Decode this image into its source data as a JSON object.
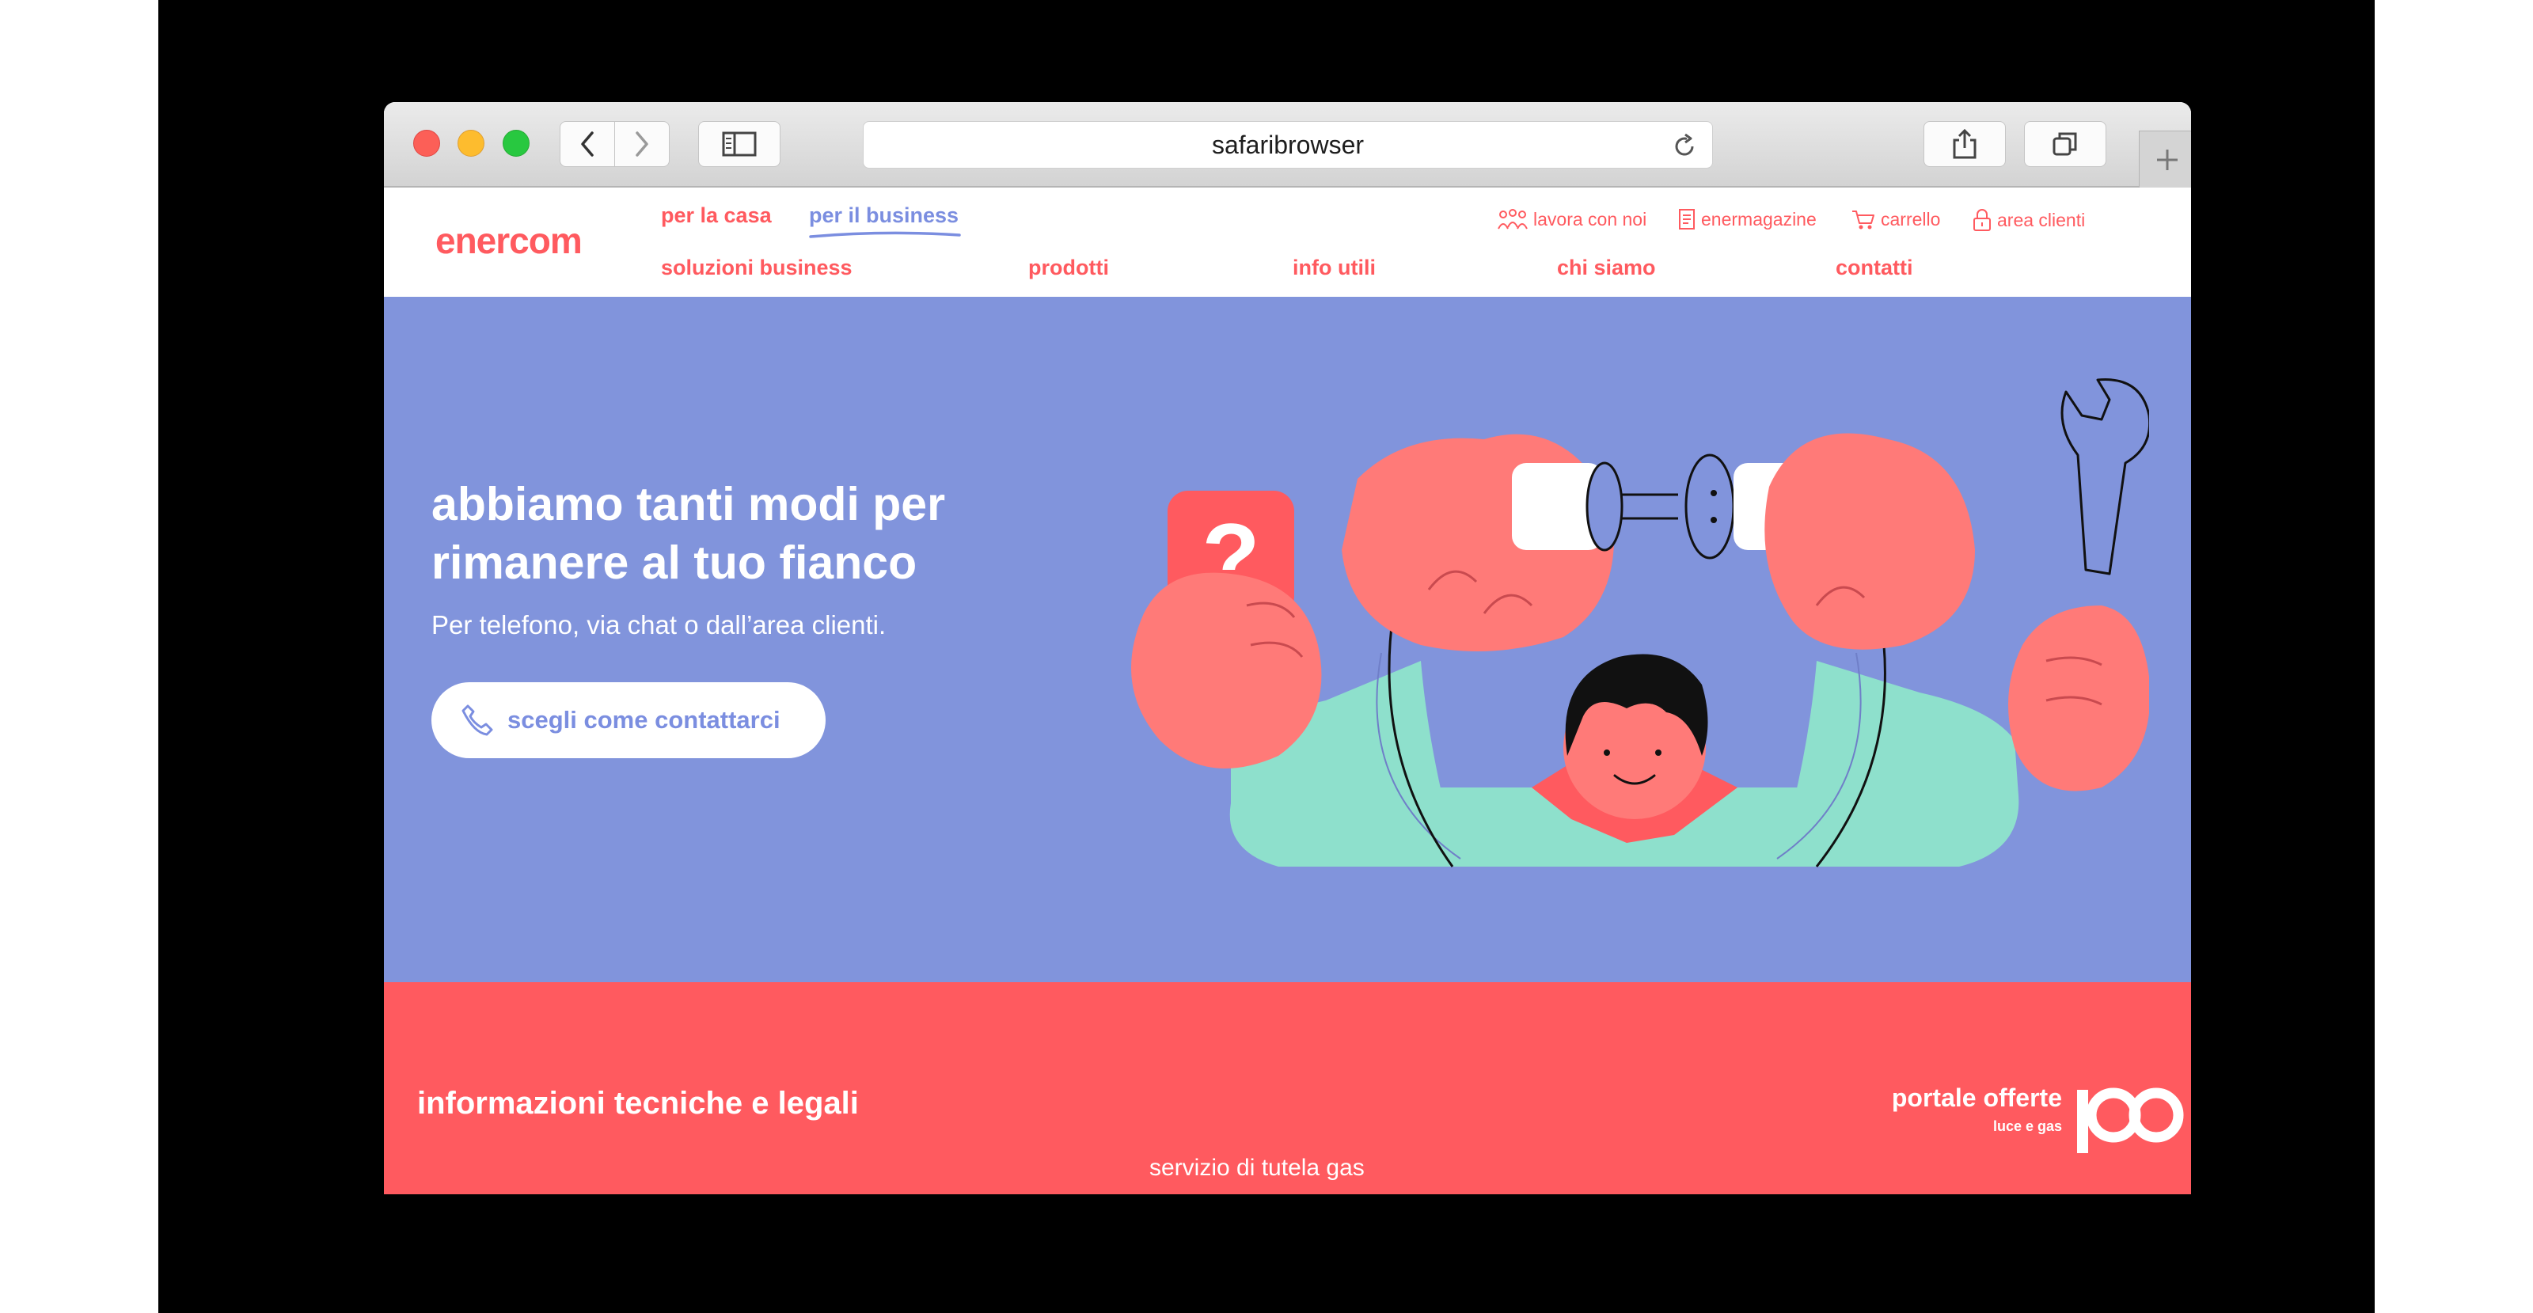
{
  "browser": {
    "url": "safaribrowser"
  },
  "header": {
    "logo": "enercom",
    "top_tabs": [
      "per la casa",
      "per il business"
    ],
    "main_nav": [
      "soluzioni business",
      "prodotti",
      "info utili",
      "chi siamo",
      "contatti"
    ],
    "utility": [
      {
        "label": "lavora con noi",
        "icon": "people-icon"
      },
      {
        "label": "enermagazine",
        "icon": "magazine-icon"
      },
      {
        "label": "carrello",
        "icon": "cart-icon"
      },
      {
        "label": "area clienti",
        "icon": "lock-icon"
      }
    ]
  },
  "hero": {
    "title": "abbiamo tanti modi per rimanere al tuo fianco",
    "subtitle": "Per telefono, via chat o dall’area clienti.",
    "cta": "scegli come contattarci"
  },
  "footer": {
    "title": "informazioni tecniche e legali",
    "link": "servizio di tutela gas",
    "portal_line1": "portale offerte",
    "portal_line2": "luce e gas",
    "portal_mark": "100"
  },
  "colors": {
    "brand": "#ff5a5f",
    "accent": "#7b8ee0",
    "hero_bg": "#8194dc",
    "mint": "#8ee0cc"
  }
}
